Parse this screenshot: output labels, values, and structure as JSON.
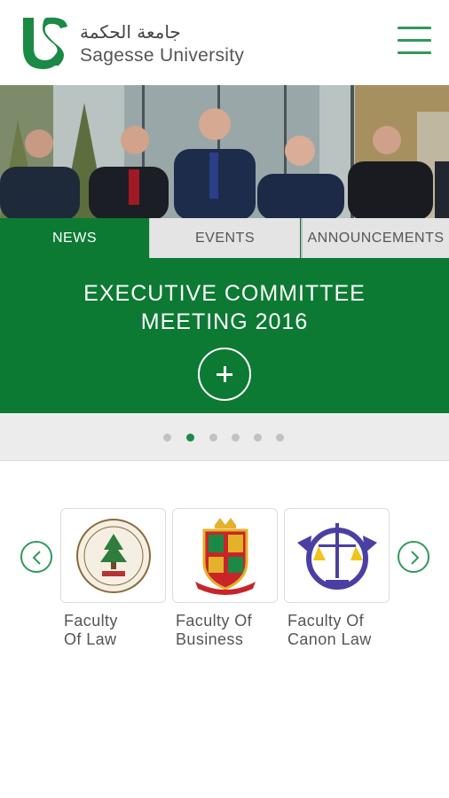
{
  "header": {
    "logo_arabic": "جامعة الحكمة",
    "logo_english": "Sagesse University",
    "brand_color": "#1a8a44",
    "menu_icon": "hamburger-menu-icon"
  },
  "hero": {
    "tabs": [
      {
        "label": "NEWS",
        "active": true
      },
      {
        "label": "EVENTS",
        "active": false
      },
      {
        "label": "ANNOUNCEMENTS",
        "active": false
      }
    ],
    "headline_line1": "EXECUTIVE COMMITTEE",
    "headline_line2": "MEETING 2016",
    "plus_icon": "plus-icon",
    "panel_color": "#0a8034"
  },
  "pager": {
    "total": 6,
    "active_index": 1
  },
  "faculties": {
    "prev_icon": "chevron-left-icon",
    "next_icon": "chevron-right-icon",
    "items": [
      {
        "line1": "Faculty",
        "line2": "Of Law",
        "icon": "law-seal-icon"
      },
      {
        "line1": "Faculty Of",
        "line2": "Business",
        "icon": "business-crest-icon"
      },
      {
        "line1": "Faculty Of",
        "line2": "Canon Law",
        "icon": "canon-law-emblem-icon"
      }
    ]
  }
}
